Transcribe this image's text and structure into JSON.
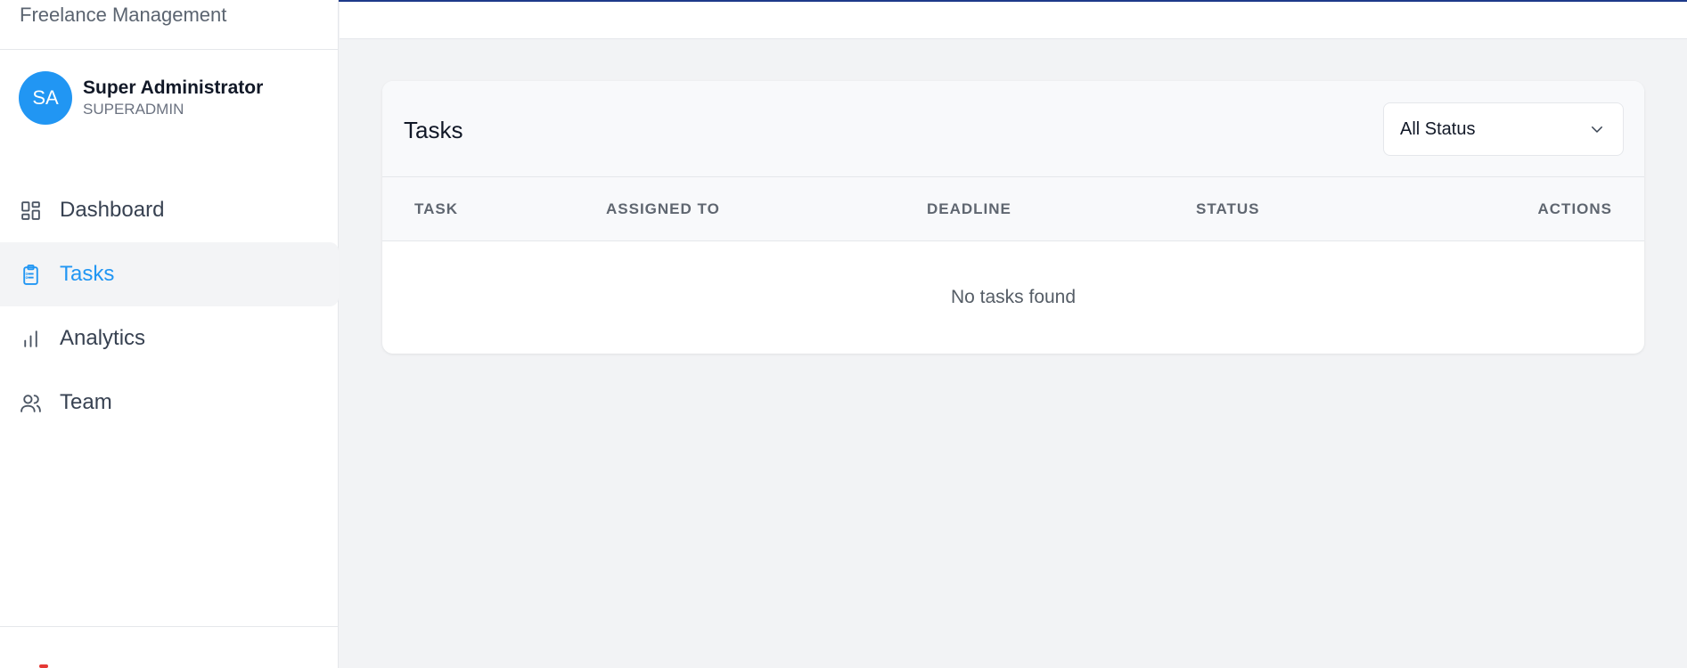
{
  "app": {
    "brand": "Freelance Management"
  },
  "user": {
    "initials": "SA",
    "name": "Super Administrator",
    "role": "SUPERADMIN"
  },
  "nav": [
    {
      "label": "Dashboard",
      "icon": "dashboard-icon",
      "active": false
    },
    {
      "label": "Tasks",
      "icon": "clipboard-icon",
      "active": true
    },
    {
      "label": "Analytics",
      "icon": "bar-chart-icon",
      "active": false
    },
    {
      "label": "Team",
      "icon": "users-icon",
      "active": false
    }
  ],
  "colors": {
    "accent": "#2196f3",
    "topline": "#1e3a8a",
    "background": "#f2f3f5"
  },
  "tasks": {
    "title": "Tasks",
    "filter": {
      "selected": "All Status",
      "icon": "chevron-down-icon"
    },
    "columns": [
      "TASK",
      "ASSIGNED TO",
      "DEADLINE",
      "STATUS",
      "ACTIONS"
    ],
    "empty_message": "No tasks found"
  }
}
